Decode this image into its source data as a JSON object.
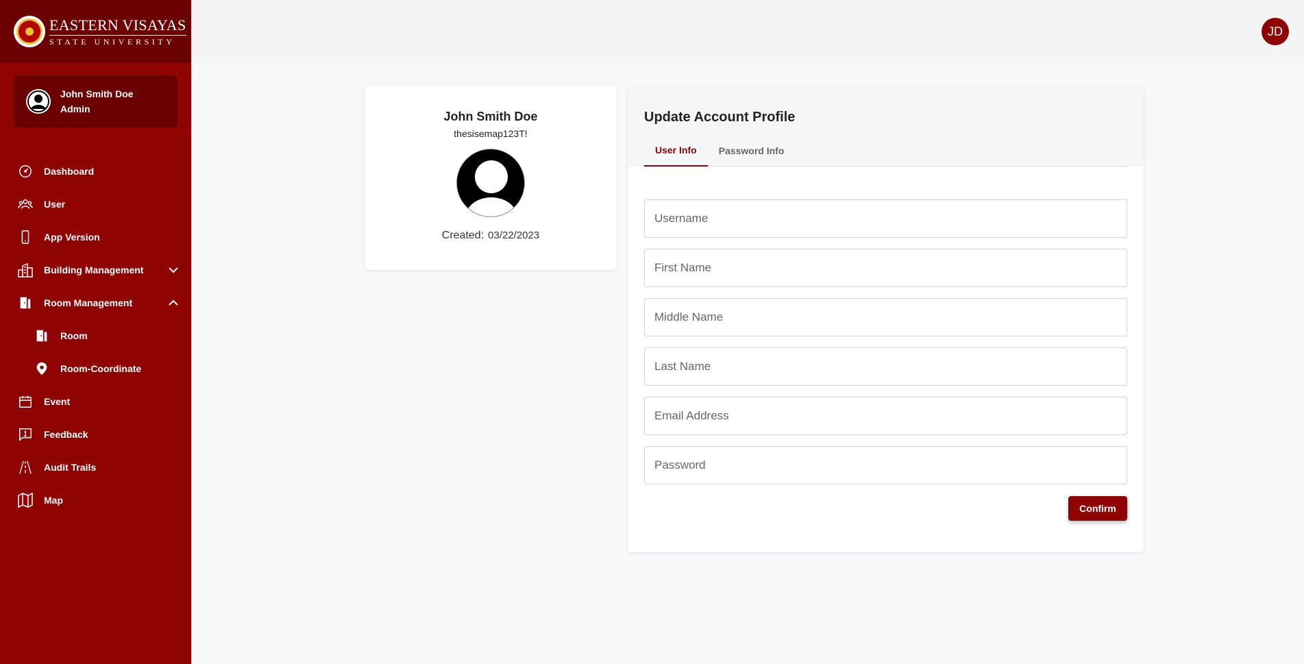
{
  "brand": {
    "line1": "EASTERN VISAYAS",
    "line2": "STATE UNIVERSITY"
  },
  "sidebar": {
    "user": {
      "name": "John Smith Doe",
      "role": "Admin"
    },
    "items": [
      {
        "label": "Dashboard",
        "icon": "dashboard-icon"
      },
      {
        "label": "User",
        "icon": "users-icon"
      },
      {
        "label": "App Version",
        "icon": "phone-icon"
      },
      {
        "label": "Building Management",
        "icon": "building-icon",
        "chevron": "chevron-down-icon"
      },
      {
        "label": "Room Management",
        "icon": "door-icon",
        "chevron": "chevron-up-icon"
      },
      {
        "label": "Room",
        "icon": "door-icon",
        "sub": true
      },
      {
        "label": "Room-Coordinate",
        "icon": "map-pin-icon",
        "sub": true
      },
      {
        "label": "Event",
        "icon": "calendar-icon"
      },
      {
        "label": "Feedback",
        "icon": "feedback-icon"
      },
      {
        "label": "Audit Trails",
        "icon": "road-icon"
      },
      {
        "label": "Map",
        "icon": "map-icon"
      }
    ]
  },
  "header": {
    "avatar_initials": "JD"
  },
  "profile": {
    "name": "John Smith Doe",
    "username": "thesisemap123T!",
    "created_label": "Created:",
    "created_date": "03/22/2023"
  },
  "update": {
    "title": "Update Account Profile",
    "tabs": [
      {
        "label": "User Info",
        "active": true
      },
      {
        "label": "Password Info",
        "active": false
      }
    ],
    "fields": {
      "username": "Username",
      "first_name": "First Name",
      "middle_name": "Middle Name",
      "last_name": "Last Name",
      "email": "Email Address",
      "password": "Password"
    },
    "confirm_label": "Confirm"
  },
  "colors": {
    "brand": "#8f0303",
    "brand_dark": "#6b0202"
  }
}
